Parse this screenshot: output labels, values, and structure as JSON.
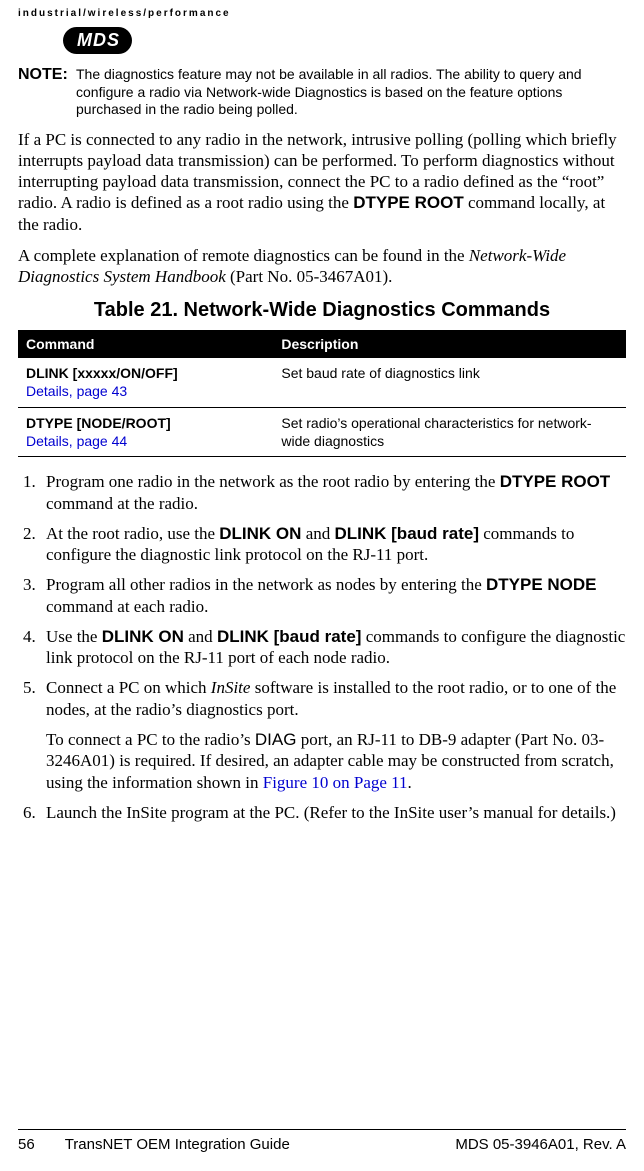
{
  "header_tag": "industrial/wireless/performance",
  "logo_text": "MDS",
  "note": {
    "label": "NOTE:",
    "body": "The diagnostics feature may not be available in all radios. The ability to query and configure a radio via Network-wide Diagnostics is based on the feature options purchased in the radio being polled."
  },
  "para1_pre": "If a PC is connected to any radio in the network, intrusive polling (polling which briefly interrupts payload data transmission) can be performed. To perform diagnostics without interrupting payload data transmission, connect the PC to a radio defined as the “root” radio. A radio is defined as a root radio using the ",
  "para1_cmd": "DTYPE ROOT",
  "para1_post": " command locally, at the radio.",
  "para2_pre": "A complete explanation of remote diagnostics can be found in the ",
  "para2_em": "Network-Wide Diagnostics System Handbook",
  "para2_post": " (Part No. 05-3467A01).",
  "table": {
    "title": "Table 21. Network-Wide Diagnostics Commands",
    "head_cmd": "Command",
    "head_desc": "Description",
    "rows": [
      {
        "cmd": "DLINK [xxxxx/ON/OFF]",
        "detail": "Details, page 43",
        "desc": "Set baud rate of diagnostics link"
      },
      {
        "cmd": "DTYPE [NODE/ROOT]",
        "detail": "Details, page 44",
        "desc": "Set radio’s operational characteristics for network-wide diagnostics"
      }
    ]
  },
  "steps": {
    "s1_pre": "Program one radio in the network as the root radio by entering the ",
    "s1_cmd": "DTYPE ROOT",
    "s1_post": " command at the radio.",
    "s2_pre": "At the root radio, use the ",
    "s2_cmd1": "DLINK ON",
    "s2_mid": " and ",
    "s2_cmd2": "DLINK [baud rate]",
    "s2_post": " commands to configure the diagnostic link protocol on the RJ-11 port.",
    "s3_pre": "Program all other radios in the network as nodes by entering the ",
    "s3_cmd": "DTYPE NODE",
    "s3_post": " command at each radio.",
    "s4_pre": "Use the ",
    "s4_cmd1": "DLINK ON",
    "s4_mid": " and ",
    "s4_cmd2": "DLINK [baud rate]",
    "s4_post": " commands to configure the diagnostic link protocol on the RJ-11 port of each node radio.",
    "s5_pre": "Connect a PC on which ",
    "s5_em": "InSite",
    "s5_post": " software is installed to the root radio, or to one of the nodes, at the radio’s diagnostics port.",
    "s5b_pre": "To connect a PC to the radio’s ",
    "s5b_sans": "DIAG",
    "s5b_mid": " port, an RJ-11 to DB-9 adapter (Part No. 03-3246A01) is required. If desired, an adapter cable may be constructed from scratch, using the information shown in ",
    "s5b_link": "Figure 10 on Page 11",
    "s5b_post": ".",
    "s6": "Launch the InSite program at the PC. (Refer to the InSite user’s manual for details.)"
  },
  "footer": {
    "page": "56",
    "mid": "TransNET OEM Integration Guide",
    "right": "MDS 05-3946A01, Rev.  A"
  }
}
